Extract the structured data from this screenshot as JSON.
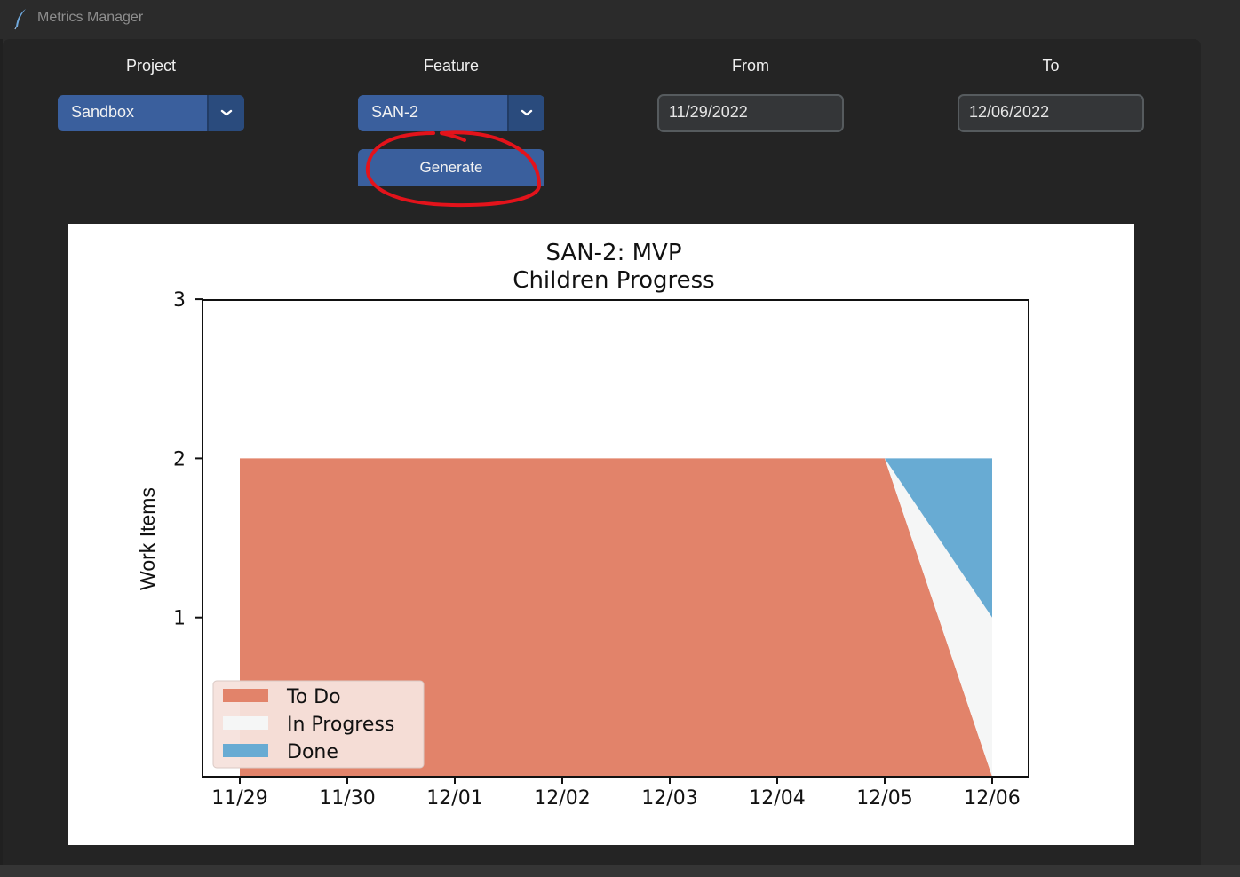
{
  "window": {
    "title": "Metrics Manager",
    "icon": "feather-icon"
  },
  "filters": {
    "project": {
      "label": "Project",
      "value": "Sandbox"
    },
    "feature": {
      "label": "Feature",
      "value": "SAN-2"
    },
    "from": {
      "label": "From",
      "value": "11/29/2022"
    },
    "to": {
      "label": "To",
      "value": "12/06/2022"
    }
  },
  "generate_label": "Generate",
  "colors": {
    "accent": "#3a5f9d",
    "annotation": "#e3131b",
    "todo": "#e2836a",
    "in_progress": "#f5f6f6",
    "done": "#68abd3"
  },
  "chart_data": {
    "type": "area",
    "stacked": true,
    "title": "SAN-2: MVP\nChildren Progress",
    "title_lines": [
      "SAN-2: MVP",
      "Children Progress"
    ],
    "xlabel": "",
    "ylabel": "Work Items",
    "x": [
      "11/29",
      "11/30",
      "12/01",
      "12/02",
      "12/03",
      "12/04",
      "12/05",
      "12/06"
    ],
    "ylim": [
      0,
      3
    ],
    "yticks": [
      1,
      2,
      3
    ],
    "grid": false,
    "legend_position": "lower-left",
    "series": [
      {
        "name": "To Do",
        "color": "#e2836a",
        "values": [
          2,
          2,
          2,
          2,
          2,
          2,
          2,
          0
        ]
      },
      {
        "name": "In Progress",
        "color": "#f5f6f6",
        "values": [
          0,
          0,
          0,
          0,
          0,
          0,
          0,
          1
        ]
      },
      {
        "name": "Done",
        "color": "#68abd3",
        "values": [
          0,
          0,
          0,
          0,
          0,
          0,
          0,
          1
        ]
      }
    ]
  }
}
